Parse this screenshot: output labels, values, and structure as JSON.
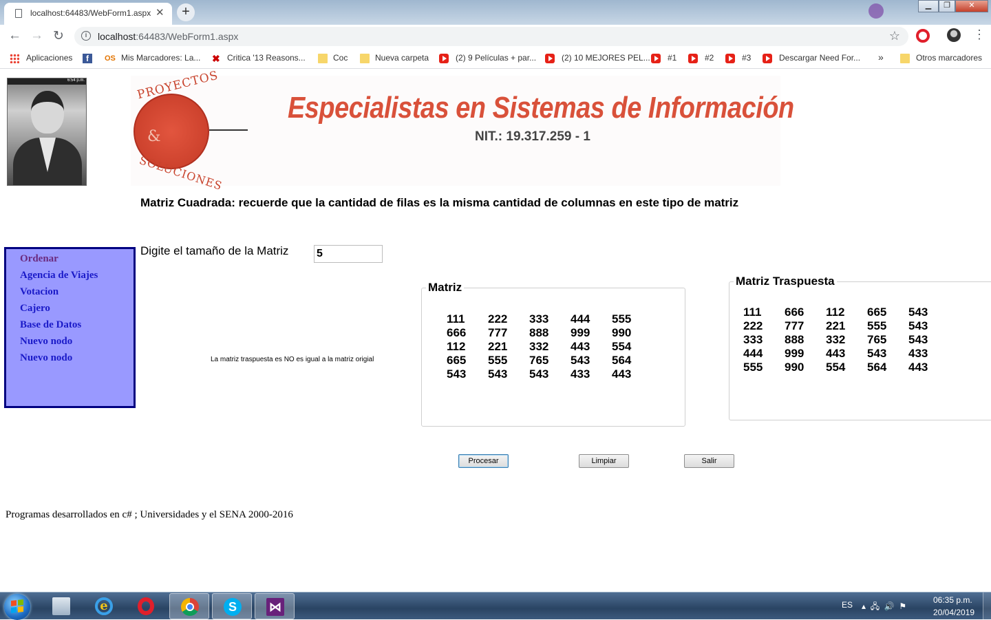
{
  "browser": {
    "tab_title": "localhost:64483/WebForm1.aspx",
    "url_host": "localhost",
    "url_rest": ":64483/WebForm1.aspx",
    "bookmarks": [
      {
        "label": "Aplicaciones",
        "icon": "apps-grid-icon"
      },
      {
        "label": "",
        "icon": "facebook-icon"
      },
      {
        "label": "Mis Marcadores: La...",
        "icon": "os-icon"
      },
      {
        "label": "Critica '13 Reasons...",
        "icon": "x-icon"
      },
      {
        "label": "Coc",
        "icon": "folder-icon"
      },
      {
        "label": "Nueva carpeta",
        "icon": "folder-icon"
      },
      {
        "label": "(2) 9 Películas + par...",
        "icon": "youtube-icon"
      },
      {
        "label": "(2) 10 MEJORES PEL...",
        "icon": "youtube-icon"
      },
      {
        "label": "#1",
        "icon": "youtube-icon"
      },
      {
        "label": "#2",
        "icon": "youtube-icon"
      },
      {
        "label": "#3",
        "icon": "youtube-icon"
      },
      {
        "label": "Descargar Need For...",
        "icon": "youtube-icon"
      }
    ],
    "overflow_label": "»",
    "other_bookmarks": "Otros marcadores"
  },
  "banner": {
    "title": "Especialistas en Sistemas de Información",
    "nit": "NIT.: 19.317.259 - 1",
    "logo_top": "PROYECTOS",
    "logo_amp": "&",
    "logo_bottom": "SOLUCIONES"
  },
  "photo": {
    "status_bar": "6:54 p.m."
  },
  "page": {
    "heading": "Matriz Cuadrada: recuerde que la cantidad de filas es la misma cantidad de columnas en este tipo de matriz",
    "size_label": "Digite el tamaño de la Matriz",
    "size_value": "5",
    "result_message": "La matriz traspuesta es NO es igual a la matriz origial",
    "footer": "Programas desarrollados en c# ; Universidades y el SENA 2000-2016"
  },
  "menu": [
    {
      "label": "Ordenar",
      "visited": true
    },
    {
      "label": "Agencia de Viajes",
      "visited": false
    },
    {
      "label": "Votacion",
      "visited": false
    },
    {
      "label": "Cajero",
      "visited": false
    },
    {
      "label": "Base de Datos",
      "visited": false
    },
    {
      "label": "Nuevo nodo",
      "visited": false
    },
    {
      "label": "Nuevo nodo",
      "visited": false
    }
  ],
  "matrix": {
    "legend": "Matriz",
    "rows": [
      [
        "111",
        "222",
        "333",
        "444",
        "555"
      ],
      [
        "666",
        "777",
        "888",
        "999",
        "990"
      ],
      [
        "112",
        "221",
        "332",
        "443",
        "554"
      ],
      [
        "665",
        "555",
        "765",
        "543",
        "564"
      ],
      [
        "543",
        "543",
        "543",
        "433",
        "443"
      ]
    ]
  },
  "transpose": {
    "legend": "Matriz Traspuesta",
    "rows": [
      [
        "111",
        "666",
        "112",
        "665",
        "543"
      ],
      [
        "222",
        "777",
        "221",
        "555",
        "543"
      ],
      [
        "333",
        "888",
        "332",
        "765",
        "543"
      ],
      [
        "444",
        "999",
        "443",
        "543",
        "433"
      ],
      [
        "555",
        "990",
        "554",
        "564",
        "443"
      ]
    ]
  },
  "buttons": {
    "procesar": "Procesar",
    "limpiar": "Limpiar",
    "salir": "Salir"
  },
  "taskbar": {
    "language": "ES",
    "time": "06:35 p.m.",
    "date": "20/04/2019"
  }
}
